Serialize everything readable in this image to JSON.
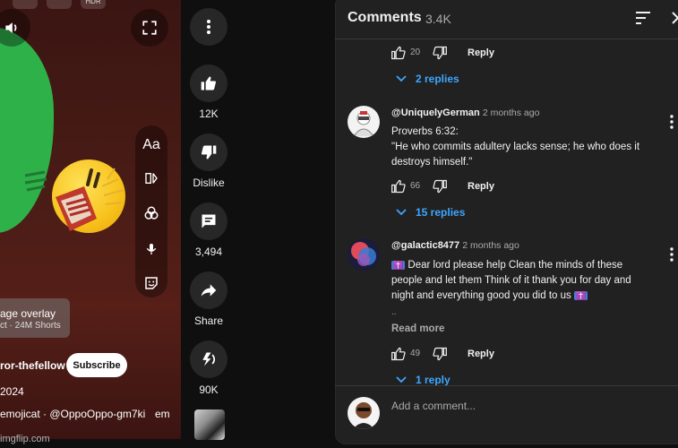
{
  "video": {
    "top_badge": "HDR",
    "overlay_title": "age overlay",
    "overlay_sub": "ct · 24M Shorts",
    "channel": "ror-thefellow",
    "subscribe_label": "Subscribe",
    "date": "2024",
    "credit": "emojicat · @OppoOppo-gm7ki",
    "credit_tail": "em",
    "effects_text_label": "Aa"
  },
  "actions": {
    "like_count": "12K",
    "dislike_label": "Dislike",
    "comment_count": "3,494",
    "share_label": "Share",
    "remix_count": "90K"
  },
  "watermark": "imgflip.com",
  "comments_panel": {
    "title": "Comments",
    "count": "3.4K",
    "add_comment_placeholder": "Add a comment..."
  },
  "top_thread": {
    "like_count": "20",
    "reply_label": "Reply",
    "replies_link": "2 replies"
  },
  "comments": [
    {
      "author": "@UniquelyGerman",
      "time": "2 months ago",
      "line1": "Proverbs 6:32:",
      "line2": "\"He who commits adultery lacks sense; he who does it",
      "line3": "destroys himself.\"",
      "like_count": "66",
      "reply_label": "Reply",
      "replies_link": "15 replies"
    },
    {
      "author": "@galactic8477",
      "time": "2 months ago",
      "cross": "✝️",
      "line1": " Dear lord please help Clean the minds of these",
      "line2": "people and let them Think of it thank you for day and",
      "line3": "night and everything good you did to us",
      "ellipsis": "..",
      "read_more": "Read more",
      "like_count": "49",
      "reply_label": "Reply",
      "replies_link": "1 reply"
    }
  ]
}
